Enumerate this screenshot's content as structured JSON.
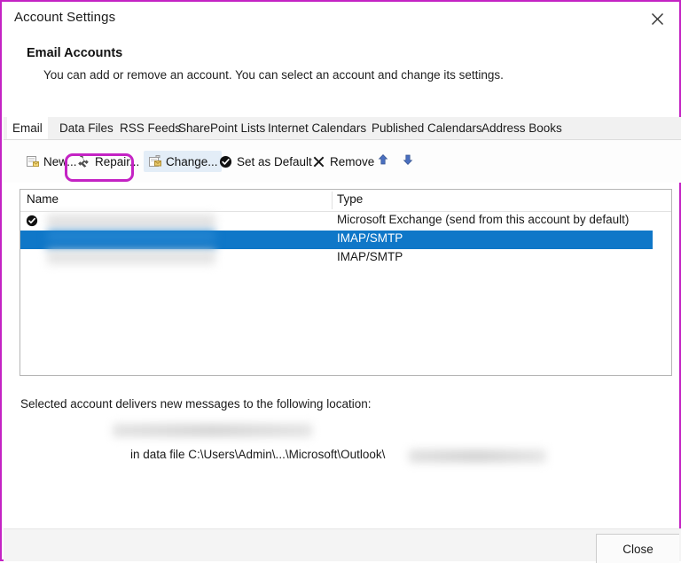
{
  "window": {
    "title": "Account Settings",
    "close_icon": "close-x-icon"
  },
  "header": {
    "title": "Email Accounts",
    "description": "You can add or remove an account. You can select an account and change its settings."
  },
  "tabs": [
    {
      "label": "Email",
      "active": true
    },
    {
      "label": "Data Files",
      "active": false
    },
    {
      "label": "RSS Feeds",
      "active": false
    },
    {
      "label": "SharePoint Lists",
      "active": false
    },
    {
      "label": "Internet Calendars",
      "active": false
    },
    {
      "label": "Published Calendars",
      "active": false
    },
    {
      "label": "Address Books",
      "active": false
    }
  ],
  "toolbar": {
    "new_label": "New...",
    "repair_label": "Repair...",
    "change_label": "Change...",
    "set_default_label": "Set as Default",
    "remove_label": "Remove",
    "move_up_icon": "arrow-up-icon",
    "move_down_icon": "arrow-down-icon",
    "highlight_color": "#c423c4"
  },
  "account_list": {
    "columns": [
      "Name",
      "Type"
    ],
    "rows": [
      {
        "name": "",
        "type": "Microsoft Exchange (send from this account by default)",
        "is_default": true,
        "selected": false
      },
      {
        "name": "",
        "type": "IMAP/SMTP",
        "is_default": false,
        "selected": true
      },
      {
        "name": "",
        "type": "IMAP/SMTP",
        "is_default": false,
        "selected": false
      }
    ],
    "selection_color": "#0f77c8"
  },
  "delivery": {
    "label": "Selected account delivers new messages to the following location:",
    "folder": "",
    "data_file_prefix": "in data file C:\\Users\\Admin\\...\\Microsoft\\Outlook\\",
    "data_file_name": ""
  },
  "footer": {
    "close_label": "Close"
  }
}
